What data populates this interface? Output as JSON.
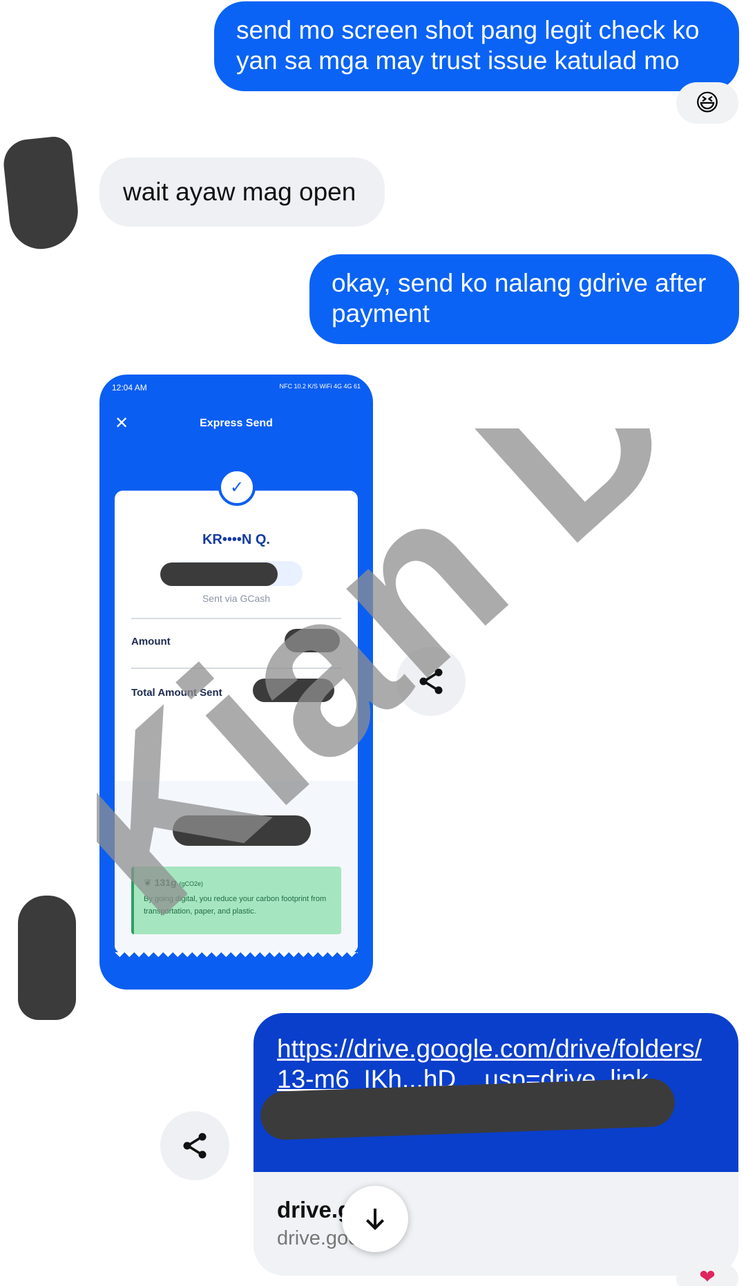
{
  "messages": {
    "msg1": "send mo screen shot pang legit check ko yan sa mga may trust issue katulad mo",
    "msg1_reaction": "😆",
    "msg2": "wait ayaw mag open",
    "msg3": "okay, send ko nalang gdrive after payment"
  },
  "screenshot": {
    "time": "12:04 AM",
    "status_icons": "NFC 10.2 K/S WiFi 4G 4G 61",
    "title": "Express Send",
    "recipient": "KR••••N Q.",
    "sent_via": "Sent via GCash",
    "amount_label": "Amount",
    "total_label": "Total Amount Sent",
    "carbon_value": "131g",
    "carbon_unit": "(gCO2e)",
    "carbon_text": "By going digital, you reduce your carbon footprint from transportation, paper, and plastic."
  },
  "link_message": {
    "url_text": "https://drive.google.com/drive/folders/13-m6_IKh...hD ...usp=drive_link",
    "domain_title": "drive.g      com",
    "domain_sub": "drive.goo      om"
  },
  "watermark": "Kian Dev",
  "icons": {
    "share": "share-icon",
    "download": "arrow-down-icon",
    "close": "close-icon",
    "check": "check-icon",
    "leaf": "leaf-icon",
    "reaction_heart": "heart-icon"
  },
  "colors": {
    "outgoing_bubble": "#0a63f4",
    "incoming_bubble": "#eef0f3",
    "gcash_blue": "#0b5ef2",
    "link_preview_blue": "#0a3fcc"
  }
}
